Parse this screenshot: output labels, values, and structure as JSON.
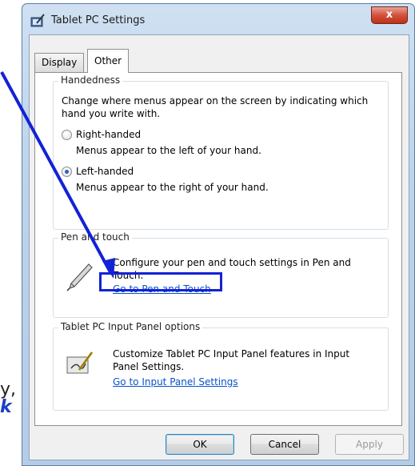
{
  "annotation": {
    "fragment_top": "y,",
    "fragment_bottom": "k"
  },
  "window": {
    "title": "Tablet PC Settings",
    "close_label": "x"
  },
  "tabs": [
    {
      "label": "Display",
      "selected": false
    },
    {
      "label": "Other",
      "selected": true
    }
  ],
  "handedness": {
    "legend": "Handedness",
    "description": "Change where menus appear on the screen by indicating which hand you write with.",
    "options": [
      {
        "label": "Right-handed",
        "note": "Menus appear to the left of your hand.",
        "checked": false
      },
      {
        "label": "Left-handed",
        "note": "Menus appear to the right of your hand.",
        "checked": true
      }
    ]
  },
  "pen_touch": {
    "legend": "Pen and touch",
    "description": "Configure your pen and touch settings in Pen and Touch.",
    "link": "Go to Pen and Touch",
    "icon": "pen-icon"
  },
  "input_panel": {
    "legend": "Tablet PC Input Panel options",
    "description": "Customize Tablet PC Input Panel features in Input Panel Settings.",
    "link": "Go to Input Panel Settings",
    "icon": "input-panel-icon"
  },
  "buttons": {
    "ok": "OK",
    "cancel": "Cancel",
    "apply": "Apply"
  },
  "colors": {
    "highlight": "#1322d6",
    "link": "#0a52c8"
  }
}
